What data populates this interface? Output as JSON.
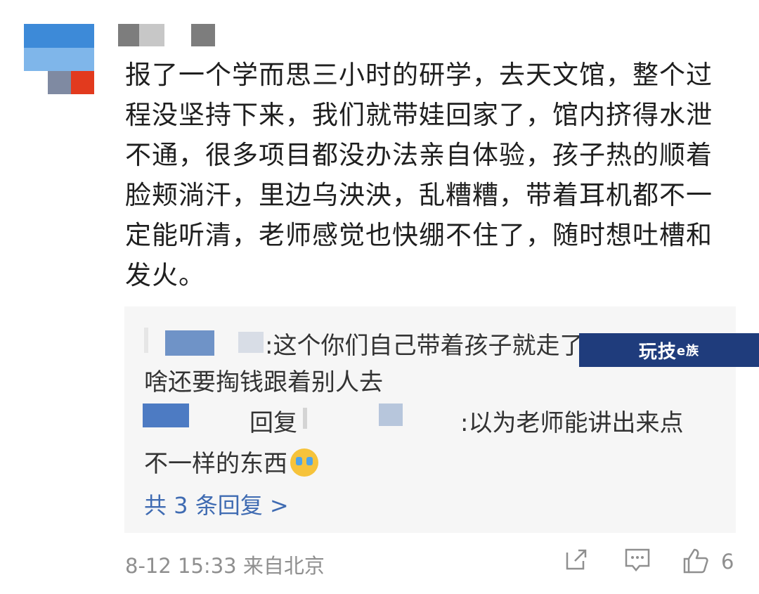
{
  "comment": {
    "text": "报了一个学而思三小时的研学，去天文馆，整个过程没坚持下来，我们就带娃回家了，馆内挤得水泄不通，很多项目都没办法亲自体验，孩子热的顺着脸颊淌汗，里边乌泱泱，乱糟糟，带着耳机都不一定能听清，老师感觉也快绷不住了，随时想吐槽和发火。",
    "time": "8-12 15:33 来自北京",
    "like_count": "6"
  },
  "replies": {
    "reply1_part1": ":这个你们自己带着孩子就走了，为",
    "reply1_part2": "啥还要掏钱跟着别人去",
    "reply2_reply_word": "回复",
    "reply2_part1": ":以为老师能讲出来点",
    "reply2_part2": "不一样的东西",
    "more_label": "共 3 条回复 >"
  },
  "watermark": {
    "text": "玩技",
    "suffix": "e族"
  },
  "icons": {
    "share": "share-icon",
    "comment": "comment-icon",
    "like": "thumbs-up-icon",
    "emoji": "crying-emoji-icon"
  },
  "colors": {
    "link": "#3f6bb2",
    "meta": "#8f8f8f",
    "reply_bg": "#f6f6f6",
    "watermark_bg": "#1f3c7c"
  }
}
